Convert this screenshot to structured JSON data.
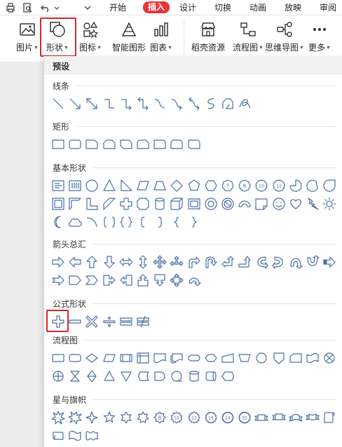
{
  "quick_access": [
    {
      "name": "print-icon"
    },
    {
      "name": "print-preview-icon"
    },
    {
      "name": "undo-icon"
    },
    {
      "name": "undo-dropdown-icon"
    },
    {
      "name": "customize-toolbar-icon"
    }
  ],
  "tabs": [
    {
      "label": "开始",
      "active": false
    },
    {
      "label": "插入",
      "active": true
    },
    {
      "label": "设计",
      "active": false
    },
    {
      "label": "切换",
      "active": false
    },
    {
      "label": "动画",
      "active": false
    },
    {
      "label": "放映",
      "active": false
    },
    {
      "label": "审阅",
      "active": false
    }
  ],
  "ribbon": [
    {
      "label": "图片",
      "icon": "picture-icon",
      "dropdown": true
    },
    {
      "label": "形状",
      "icon": "shapes-icon",
      "dropdown": true,
      "highlighted": true
    },
    {
      "label": "图标",
      "icon": "icons-icon",
      "dropdown": true
    },
    {
      "label": "智能图形",
      "icon": "smartart-icon",
      "dropdown": false
    },
    {
      "label": "图表",
      "icon": "chart-icon",
      "dropdown": true
    },
    {
      "label": "稻壳资源",
      "icon": "store-icon",
      "dropdown": false
    },
    {
      "label": "流程图",
      "icon": "flowchart-icon",
      "dropdown": true
    },
    {
      "label": "思维导图",
      "icon": "mindmap-icon",
      "dropdown": true
    },
    {
      "label": "更多",
      "icon": "more-icon",
      "dropdown": true
    }
  ],
  "panel": {
    "preset_label": "预设",
    "sections": [
      {
        "title": "线条",
        "rows": [
          [
            "line",
            "arrow",
            "double-arrow",
            "elbow",
            "elbow-arrow",
            "elbow-double-arrow",
            "curve",
            "curve-arrow",
            "curve-double-arrow",
            "s-curve",
            "freeform",
            "scribble"
          ]
        ]
      },
      {
        "title": "矩形",
        "rows": [
          [
            "rect",
            "round-rect",
            "snip-one",
            "snip-two",
            "snip-diag",
            "snip-round",
            "round-one",
            "round-two",
            "round-diag"
          ]
        ]
      },
      {
        "title": "基本形状",
        "rows": [
          [
            "textbox",
            "vtextbox",
            "ellipse",
            "triangle",
            "right-triangle",
            "parallelogram",
            "trapezoid",
            "diamond",
            "pentagon",
            "hexagon",
            "heptagon",
            "octagon",
            "decagon",
            "dodecagon",
            "pie",
            "chord",
            "teardrop"
          ],
          [
            "frame",
            "half-frame",
            "l-shape",
            "diag-stripe",
            "cross",
            "plaque",
            "can",
            "cube",
            "bevel",
            "donut",
            "no-symbol",
            "block-arc",
            "folded-corner",
            "smiley",
            "heart",
            "lightning",
            "sun"
          ],
          [
            "moon",
            "cloud",
            "arc",
            "double-bracket",
            "double-brace",
            "left-bracket",
            "right-bracket",
            "left-brace",
            "right-brace"
          ]
        ]
      },
      {
        "title": "箭头总汇",
        "rows": [
          [
            "arrow-right",
            "arrow-left",
            "arrow-up",
            "arrow-down",
            "arrow-lr",
            "arrow-ud",
            "arrow-quad",
            "arrow-lru",
            "arrow-bent",
            "arrow-uturn",
            "arrow-leftup",
            "arrow-bentup",
            "arrow-curved-r",
            "arrow-curved-l",
            "arrow-curved-u",
            "arrow-curved-d",
            "arrow-striped"
          ],
          [
            "arrow-notched",
            "pentagon-arrow",
            "chevron",
            "callout-right",
            "callout-left",
            "callout-up",
            "callout-down",
            "callout-quad",
            "circular-arrow"
          ]
        ]
      },
      {
        "title": "公式形状",
        "rows": [
          [
            "plus",
            "minus",
            "multiply",
            "divide",
            "equal",
            "not-equal"
          ]
        ]
      },
      {
        "title": "流程图",
        "rows": [
          [
            "process",
            "alt-process",
            "decision",
            "data",
            "predefined",
            "internal-storage",
            "document",
            "multidoc",
            "terminator",
            "preparation",
            "manual-input",
            "manual-op",
            "connector",
            "offpage",
            "punched-card",
            "punched-tape",
            "summing"
          ],
          [
            "or",
            "collate",
            "sort",
            "extract",
            "merge",
            "stored-data",
            "delay",
            "seq-storage",
            "magnetic-disk",
            "direct-storage",
            "display"
          ]
        ]
      },
      {
        "title": "星与旗帜",
        "rows": [
          [
            "explosion1",
            "explosion2",
            "star4",
            "star5",
            "star6",
            "star7",
            "star8",
            "star10",
            "star12",
            "star16",
            "star24",
            "star32",
            "ribbon-up",
            "ribbon-down",
            "curved-ribbon-up",
            "curved-ribbon-down",
            "scroll-v"
          ],
          [
            "scroll-h",
            "wave",
            "double-wave"
          ]
        ]
      }
    ],
    "number_labels": {
      "heptagon": "7",
      "octagon": "8",
      "decagon": "10",
      "dodecagon": "12",
      "star8": "8",
      "star10": "10",
      "star12": "12",
      "star16": "16",
      "star24": "24",
      "star32": "32"
    }
  },
  "colors": {
    "accent": "#e8343a",
    "highlight_border": "#d8262c",
    "shape_stroke": "#4a6fa5"
  }
}
